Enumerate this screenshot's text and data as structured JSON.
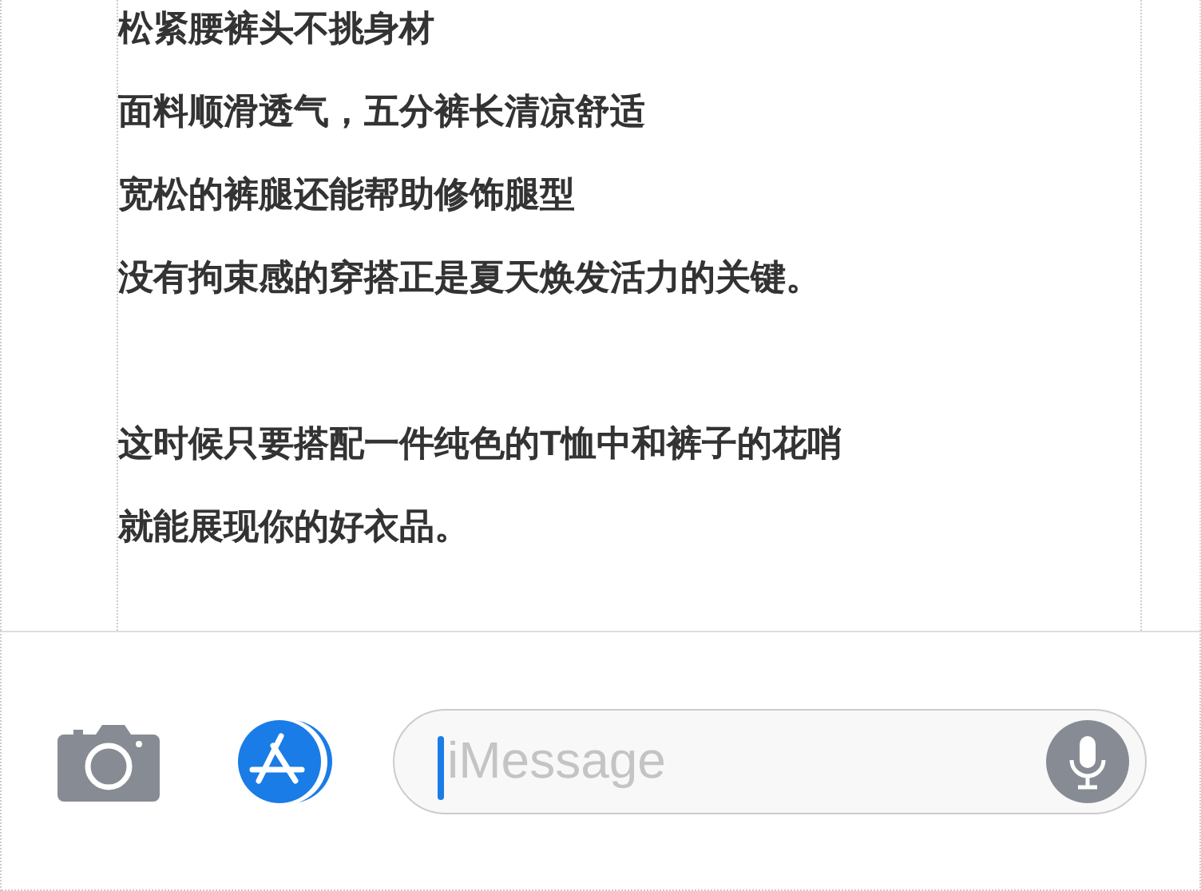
{
  "paragraphs": [
    [
      "松紧腰裤头不挑身材",
      "面料顺滑透气，五分裤长清凉舒适",
      "宽松的裤腿还能帮助修饰腿型",
      "没有拘束感的穿搭正是夏天焕发活力的关键。"
    ],
    [
      "这时候只要搭配一件纯色的T恤中和裤子的花哨",
      "就能展现你的好衣品。"
    ]
  ],
  "composer": {
    "placeholder": "iMessage",
    "focused": true
  }
}
